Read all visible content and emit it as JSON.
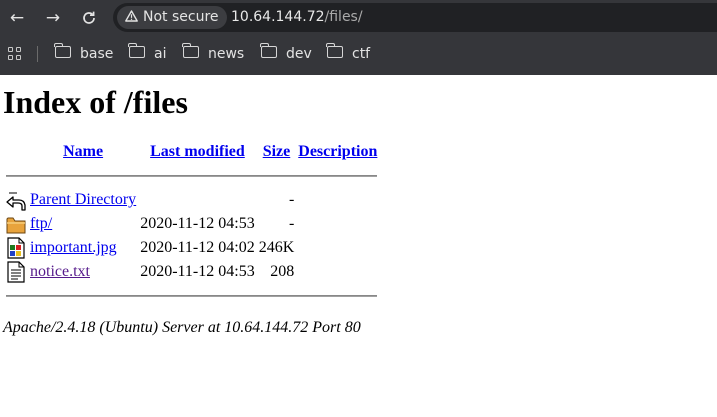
{
  "browser": {
    "security_label": "Not secure",
    "url_host": "10.64.144.72",
    "url_path": "/files/",
    "bookmarks": [
      {
        "label": "base",
        "icon": "folder-icon"
      },
      {
        "label": "ai",
        "icon": "folder-icon"
      },
      {
        "label": "news",
        "icon": "folder-icon"
      },
      {
        "label": "dev",
        "icon": "folder-icon"
      },
      {
        "label": "ctf",
        "icon": "folder-icon"
      }
    ]
  },
  "page": {
    "title": "Index of /files",
    "columns": {
      "name": "Name",
      "last_modified": "Last modified",
      "size": "Size",
      "description": "Description"
    },
    "rows": [
      {
        "name": "Parent Directory",
        "last_modified": "",
        "size": "-",
        "icon": "back-arrow-icon",
        "visited": false
      },
      {
        "name": "ftp/",
        "last_modified": "2020-11-12 04:53",
        "size": "-",
        "icon": "folder-icon",
        "visited": false
      },
      {
        "name": "important.jpg",
        "last_modified": "2020-11-12 04:02",
        "size": "246K",
        "icon": "image-file-icon",
        "visited": false
      },
      {
        "name": "notice.txt",
        "last_modified": "2020-11-12 04:53",
        "size": "208",
        "icon": "text-file-icon",
        "visited": true
      }
    ],
    "footer": "Apache/2.4.18 (Ubuntu) Server at 10.64.144.72 Port 80"
  },
  "colors": {
    "link": "#0000ee",
    "visited_link": "#551a8b",
    "chrome_bg": "#35363a"
  }
}
